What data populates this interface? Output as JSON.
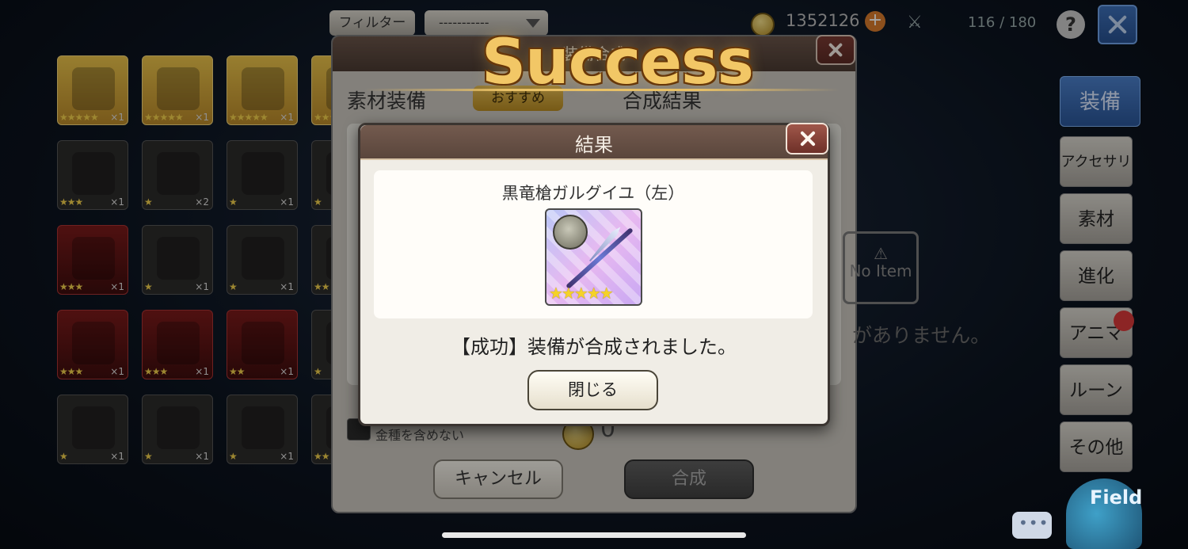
{
  "topbar": {
    "filter_label": "フィルター",
    "filter_value": "-----------",
    "gold_amount": "1352126",
    "gold_plus": "+",
    "inventory_count": "116 / 180",
    "help": "?"
  },
  "grid": {
    "tiles": [
      {
        "variant": "gold",
        "stars": "★★★★★",
        "count": "×1"
      },
      {
        "variant": "gold",
        "stars": "★★★★★",
        "count": "×1"
      },
      {
        "variant": "gold",
        "stars": "★★★★★",
        "count": "×1"
      },
      {
        "variant": "gold",
        "stars": "★★★",
        "count": ""
      },
      {
        "variant": "dark",
        "stars": "★★★",
        "count": "×1"
      },
      {
        "variant": "dark",
        "stars": "★",
        "count": "×2"
      },
      {
        "variant": "dark",
        "stars": "★",
        "count": "×1"
      },
      {
        "variant": "dark",
        "stars": "★",
        "count": ""
      },
      {
        "variant": "red",
        "stars": "★★★",
        "count": "×1"
      },
      {
        "variant": "dark",
        "stars": "★",
        "count": "×1"
      },
      {
        "variant": "dark",
        "stars": "★",
        "count": "×1"
      },
      {
        "variant": "dark",
        "stars": "★★",
        "count": ""
      },
      {
        "variant": "red",
        "stars": "★★★",
        "count": "×1"
      },
      {
        "variant": "red",
        "stars": "★★★",
        "count": "×1"
      },
      {
        "variant": "red",
        "stars": "★★",
        "count": "×1"
      },
      {
        "variant": "dark",
        "stars": "★",
        "count": ""
      },
      {
        "variant": "dark",
        "stars": "★",
        "count": "×1"
      },
      {
        "variant": "dark",
        "stars": "★",
        "count": "×1"
      },
      {
        "variant": "dark",
        "stars": "★",
        "count": "×1"
      },
      {
        "variant": "dark",
        "stars": "★★",
        "count": ""
      }
    ]
  },
  "side_tabs": {
    "equipment": "装備",
    "accessory": "アクセサリ",
    "material": "素材",
    "evolution": "進化",
    "anima": "アニマ",
    "rune": "ルーン",
    "other": "その他"
  },
  "synthesis_panel": {
    "title": "装備合成",
    "material_label": "素材装備",
    "recommend_label": "おすすめ",
    "result_label": "合成結果",
    "no_item": "No Item",
    "no_items_message": "がありません。",
    "exclude_gold_label": "金種を含めない",
    "gold_cost": "0",
    "cancel_label": "キャンセル",
    "synthesize_label": "合成"
  },
  "success_banner": "Success",
  "result_dialog": {
    "title": "結果",
    "item_name": "黒竜槍ガルグイユ（左）",
    "item_stars": "★★★★★",
    "message": "【成功】装備が合成されました。",
    "close_label": "閉じる"
  },
  "footer": {
    "field_label": "Field"
  }
}
